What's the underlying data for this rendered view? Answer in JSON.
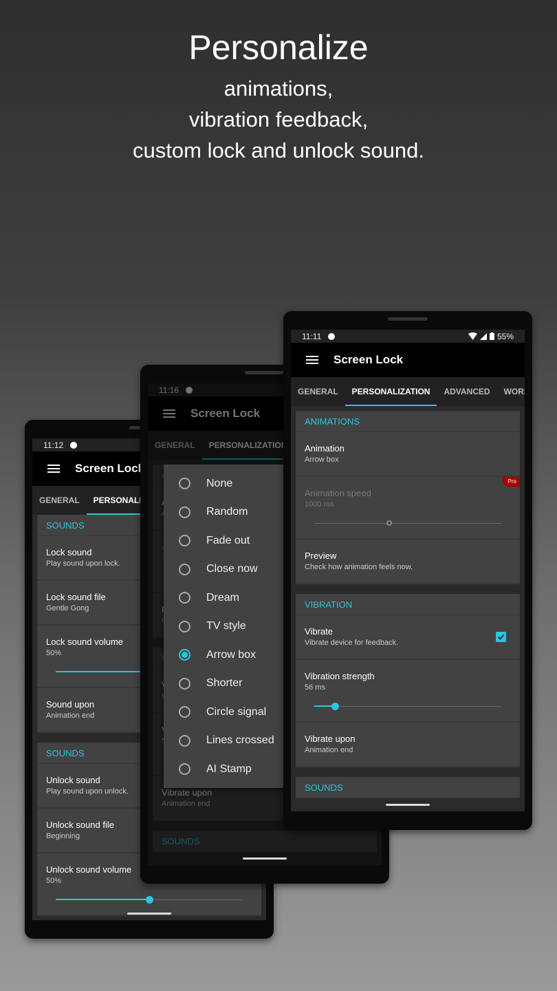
{
  "headline": {
    "title": "Personalize",
    "lines": [
      "animations,",
      "vibration feedback,",
      "custom lock and unlock sound."
    ]
  },
  "colors": {
    "accent": "#2bc6dd",
    "pro_badge": "#aa0000"
  },
  "app_title": "Screen Lock",
  "personalization_sections": [
    {
      "header": "ANIMATIONS",
      "rows": [
        {
          "title": "Animation",
          "summary": "Arrow box"
        },
        {
          "title": "Animation speed",
          "summary": "1000 ms",
          "type": "slider",
          "value_fraction": 0.4,
          "disabled": true,
          "pro": "Pro"
        },
        {
          "title": "Preview",
          "summary": "Check how animation feels now."
        }
      ]
    },
    {
      "header": "VIBRATION",
      "rows": [
        {
          "title": "Vibrate",
          "summary": "Vibrate device for feedback.",
          "type": "checkbox",
          "checked": true
        },
        {
          "title": "Vibration strength",
          "summary": "56 ms",
          "type": "slider",
          "value_fraction": 0.11
        },
        {
          "title": "Vibrate upon",
          "summary": "Animation end"
        }
      ]
    },
    {
      "header": "SOUNDS",
      "rows": []
    }
  ],
  "phones": [
    {
      "time": "11:12",
      "tabs": [
        "GENERAL",
        "PERSONALIZ"
      ],
      "active_tab": 1,
      "sections": [
        {
          "header": "SOUNDS",
          "rows": [
            {
              "title": "Lock sound",
              "summary": "Play sound upon lock."
            },
            {
              "title": "Lock sound file",
              "summary": "Gentle Gong"
            },
            {
              "title": "Lock sound volume",
              "summary": "50%",
              "type": "slider",
              "value_fraction": 0.5
            },
            {
              "title": "Sound upon",
              "summary": "Animation end"
            }
          ]
        },
        {
          "header": "SOUNDS",
          "rows": [
            {
              "title": "Unlock sound",
              "summary": "Play sound upon unlock."
            },
            {
              "title": "Unlock sound file",
              "summary": "Beginning"
            },
            {
              "title": "Unlock sound volume",
              "summary": "50%",
              "type": "slider",
              "value_fraction": 0.5
            }
          ]
        }
      ]
    },
    {
      "time": "11:16",
      "tabs": [
        "GENERAL",
        "PERSONALIZATION"
      ],
      "active_tab": 1,
      "dialog": {
        "options": [
          "None",
          "Random",
          "Fade out",
          "Close now",
          "Dream",
          "TV style",
          "Arrow box",
          "Shorter",
          "Circle signal",
          "Lines crossed",
          "AI Stamp"
        ],
        "selected": "Arrow box"
      }
    },
    {
      "time": "11:11",
      "battery": "55%",
      "status_icons": [
        "wifi-icon",
        "signal-icon",
        "battery-icon"
      ],
      "tabs": [
        "GENERAL",
        "PERSONALIZATION",
        "ADVANCED",
        "WORKA"
      ],
      "active_tab": 1
    }
  ]
}
